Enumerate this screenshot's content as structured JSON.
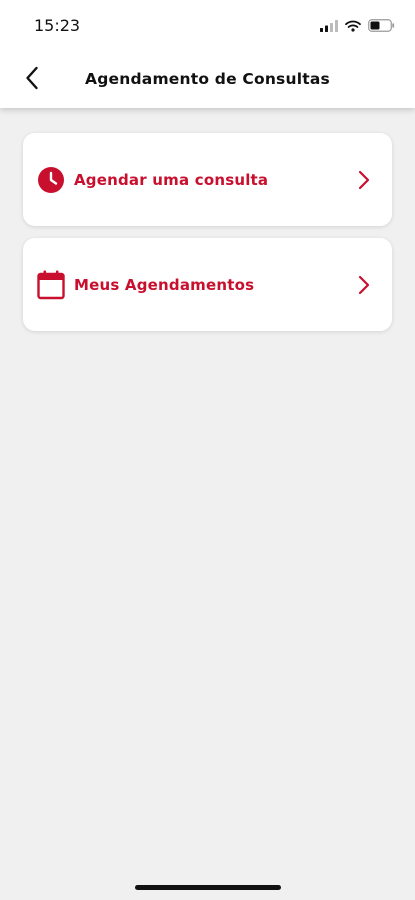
{
  "status_bar": {
    "time": "15:23",
    "icons": [
      "signal-icon",
      "wifi-icon",
      "battery-icon"
    ]
  },
  "header": {
    "title": "Agendamento de Consultas",
    "back_icon": "chevron-left-icon"
  },
  "menu": [
    {
      "label": "Agendar uma consulta",
      "icon": "clock-icon"
    },
    {
      "label": "Meus Agendamentos",
      "icon": "calendar-icon"
    }
  ],
  "colors": {
    "accent": "#c8102e",
    "background": "#f0f0f0",
    "card": "#ffffff"
  }
}
